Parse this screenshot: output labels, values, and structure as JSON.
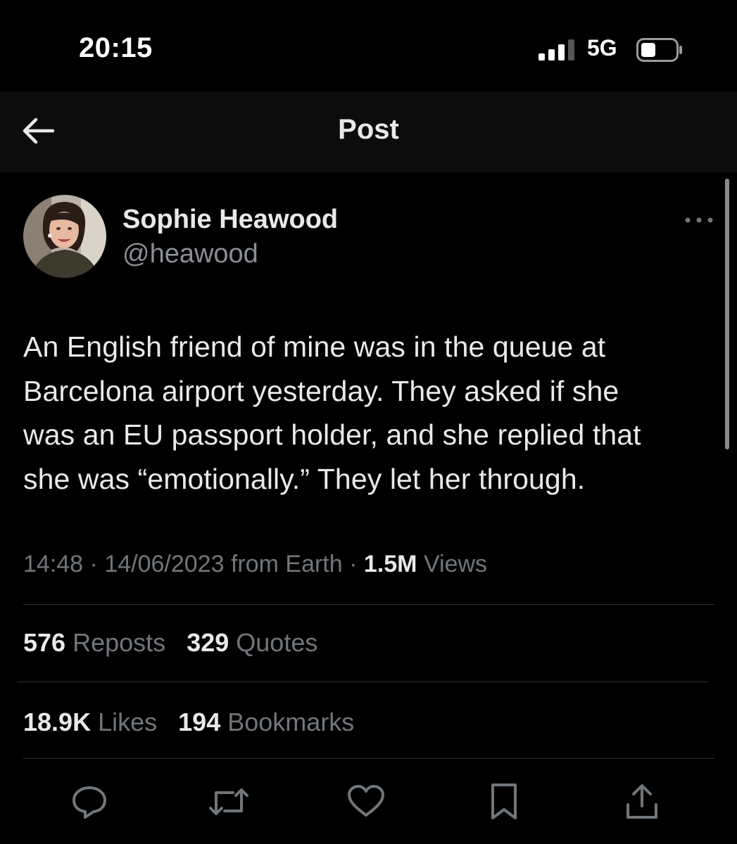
{
  "status_bar": {
    "time": "20:15",
    "network": "5G",
    "signal_bars_active": 3,
    "signal_bars_total": 4
  },
  "header": {
    "title": "Post",
    "back_icon": "arrow-left-icon"
  },
  "post": {
    "author_name": "Sophie Heawood",
    "author_handle": "@heawood",
    "lines": [
      "An English friend of mine was in the queue at",
      "Barcelona airport yesterday. They asked if she",
      "was an EU passport holder, and she replied that",
      "she was “emotionally.” They let her through."
    ],
    "time": "14:48",
    "date": "14/06/2023",
    "source": "from Earth",
    "separator": "·",
    "views_count": "1.5M",
    "views_label": "Views"
  },
  "stats": {
    "reposts_count": "576",
    "reposts_label": "Reposts",
    "quotes_count": "329",
    "quotes_label": "Quotes",
    "likes_count": "18.9K",
    "likes_label": "Likes",
    "bookmarks_count": "194",
    "bookmarks_label": "Bookmarks"
  },
  "actions": [
    "reply-icon",
    "repost-icon",
    "like-icon",
    "bookmark-icon",
    "share-icon"
  ],
  "colors": {
    "background": "#000000",
    "primary_text": "#e7e9ea",
    "secondary_text": "#71767b",
    "divider": "#2f3336"
  }
}
